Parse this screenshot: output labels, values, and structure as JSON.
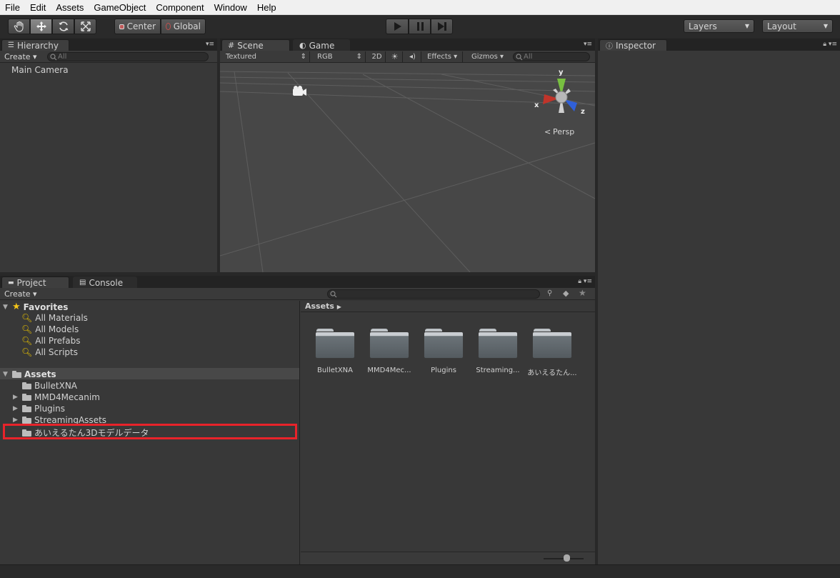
{
  "menu": [
    "File",
    "Edit",
    "Assets",
    "GameObject",
    "Component",
    "Window",
    "Help"
  ],
  "toolbar": {
    "tools": [
      "hand-tool",
      "move-tool",
      "rotate-tool",
      "scale-tool"
    ],
    "pivot_center": "Center",
    "pivot_global": "Global",
    "layers_label": "Layers",
    "layout_label": "Layout"
  },
  "hierarchy": {
    "tab": "Hierarchy",
    "create": "Create",
    "search_placeholder": "All",
    "items": [
      "Main Camera"
    ]
  },
  "scene": {
    "tab_scene": "Scene",
    "tab_game": "Game",
    "shading": "Textured",
    "render_mode": "RGB",
    "mode_2d": "2D",
    "effects": "Effects",
    "gizmos": "Gizmos",
    "search_placeholder": "All",
    "axis_x": "x",
    "axis_y": "y",
    "axis_z": "z",
    "projection": "Persp"
  },
  "inspector": {
    "tab": "Inspector"
  },
  "project": {
    "tab_project": "Project",
    "tab_console": "Console",
    "create": "Create",
    "favorites_label": "Favorites",
    "favorites": [
      "All Materials",
      "All Models",
      "All Prefabs",
      "All Scripts"
    ],
    "assets_label": "Assets",
    "assets_tree": [
      "BulletXNA",
      "MMD4Mecanim",
      "Plugins",
      "StreamingAssets",
      "あいえるたん3Dモデルデータ"
    ],
    "breadcrumb": "Assets",
    "grid_items": [
      "BulletXNA",
      "MMD4Mec...",
      "Plugins",
      "Streaming...",
      "あいえるたん..."
    ],
    "highlight_color": "#e8232a"
  }
}
